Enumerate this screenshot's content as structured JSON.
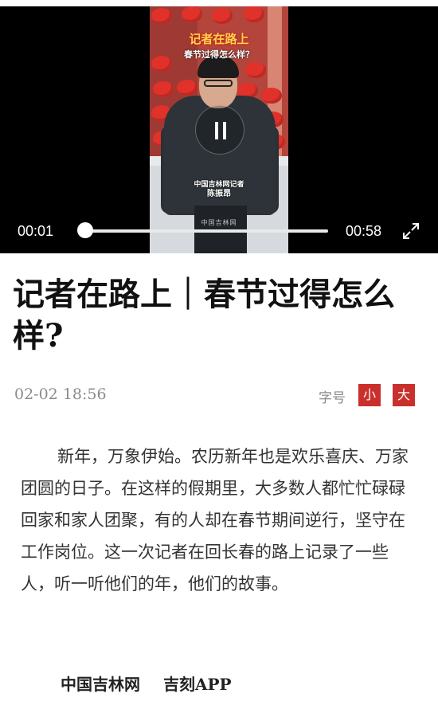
{
  "video": {
    "caption_title": "记者在路上",
    "caption_subtitle": "春节过得怎么样？",
    "reporter_label": "中国吉林网记者",
    "reporter_name": "陈振昂",
    "watermark": "中国吉林网",
    "current_time": "00:01",
    "total_time": "00:58",
    "progress_fraction": 0.017,
    "state": "playing",
    "pause_icon": "pause-icon",
    "fullscreen_icon": "fullscreen-icon"
  },
  "article": {
    "title": "记者在路上｜春节过得怎么样?",
    "date": "02-02  18:56",
    "font_size_label": "字号",
    "font_small_label": "小",
    "font_large_label": "大",
    "body": "新年，万象伊始。农历新年也是欢乐喜庆、万家团圆的日子。在这样的假期里，大多数人都忙忙碌碌回家和家人团聚，有的人却在春节期间逆行，坚守在工作岗位。这一次记者在回长春的路上记录了一些人，听一听他们的年，他们的故事。",
    "source_1": "中国吉林网",
    "source_2": "吉刻APP"
  },
  "colors": {
    "accent_red": "#c9302c",
    "meta_gray": "#8a8a8a"
  }
}
